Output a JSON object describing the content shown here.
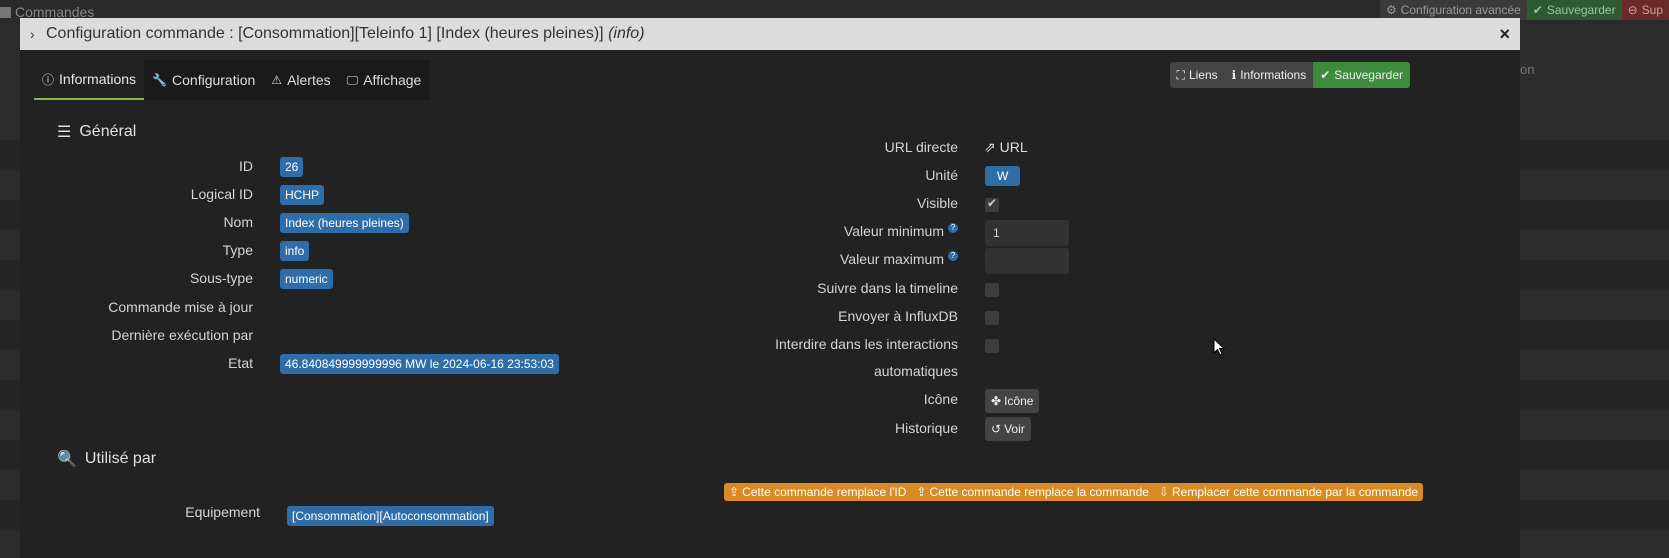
{
  "background": {
    "title": "Commandes",
    "buttons": {
      "advanced": "Configuration avancée",
      "save": "Sauvegarder",
      "delete": "Sup"
    },
    "right_text": "on"
  },
  "modal": {
    "title_main": "Configuration commande : [Consommation][Teleinfo 1] [Index (heures pleines)]",
    "title_type": "(info)",
    "close_label": "×"
  },
  "tabs": [
    {
      "label": "Informations",
      "icon": "info-circle-icon"
    },
    {
      "label": "Configuration",
      "icon": "wrench-icon"
    },
    {
      "label": "Alertes",
      "icon": "warning-icon"
    },
    {
      "label": "Affichage",
      "icon": "monitor-icon"
    }
  ],
  "top_buttons": {
    "links": "Liens",
    "informations": "Informations",
    "save": "Sauvegarder"
  },
  "general": {
    "title": "Général",
    "fields": {
      "id": {
        "label": "ID",
        "value": "26"
      },
      "logical_id": {
        "label": "Logical ID",
        "value": "HCHP"
      },
      "name": {
        "label": "Nom",
        "value": "Index (heures pleines)"
      },
      "type": {
        "label": "Type",
        "value": "info"
      },
      "subtype": {
        "label": "Sous-type",
        "value": "numeric"
      },
      "update_cmd": {
        "label": "Commande mise à jour"
      },
      "last_exec": {
        "label": "Dernière exécution par"
      },
      "state": {
        "label": "Etat",
        "value": "46.840849999999996 MW le 2024-06-16 23:53:03"
      }
    }
  },
  "right": {
    "url": {
      "label": "URL directe",
      "link": "URL"
    },
    "unit": {
      "label": "Unité",
      "value": "W"
    },
    "visible": {
      "label": "Visible",
      "checked": true
    },
    "min": {
      "label": "Valeur minimum",
      "value": "1",
      "help": "?"
    },
    "max": {
      "label": "Valeur maximum",
      "value": "",
      "help": "?"
    },
    "timeline": {
      "label": "Suivre dans la timeline",
      "checked": false
    },
    "influx": {
      "label": "Envoyer à InfluxDB",
      "checked": false
    },
    "interactions": {
      "label_line1": "Interdire dans les interactions",
      "label_line2": "automatiques",
      "checked": false
    },
    "icon": {
      "label": "Icône",
      "button": "Icône"
    },
    "history": {
      "label": "Historique",
      "button": "Voir"
    }
  },
  "used_by": {
    "title": "Utilisé par",
    "equipment_label": "Equipement",
    "equipment_value": "[Consommation][Autoconsommation]"
  },
  "orange_buttons": {
    "replace_id": "Cette commande remplace l'ID",
    "replace_cmd": "Cette commande remplace la commande",
    "replace_by": "Remplacer cette commande par la commande"
  },
  "colors": {
    "accent_blue": "#2f6da8",
    "save_green": "#3c8c3c",
    "orange": "#d98a22",
    "tab_active": "#8fb34a"
  }
}
